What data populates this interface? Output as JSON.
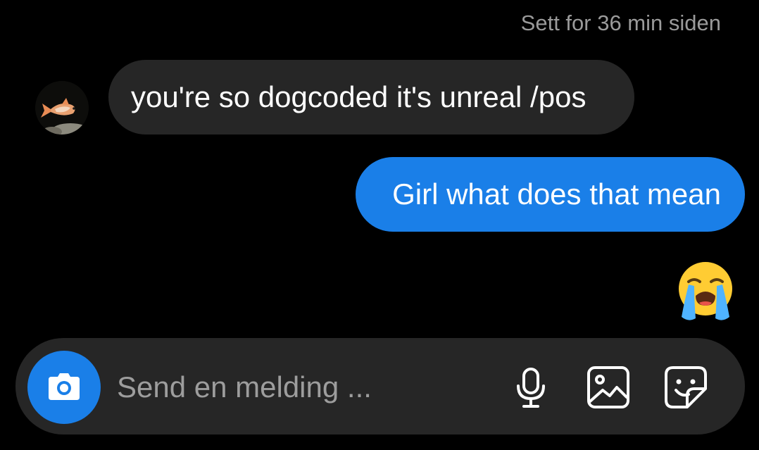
{
  "status": {
    "seen_text": "Sett for 36 min siden"
  },
  "messages": [
    {
      "direction": "incoming",
      "text": "you're so dogcoded it's unreal /pos"
    },
    {
      "direction": "outgoing",
      "text": "Girl what does that mean"
    }
  ],
  "reaction": {
    "icon": "loudly-crying-face-emoji"
  },
  "composer": {
    "placeholder": "Send en melding ...",
    "value": "",
    "buttons": [
      "camera-icon",
      "microphone-icon",
      "image-icon",
      "sticker-icon"
    ]
  },
  "colors": {
    "background": "#000000",
    "incoming_bubble": "#262626",
    "outgoing_bubble": "#1a7fe8",
    "composer": "#262626",
    "accent": "#1a7fe8",
    "muted_text": "#9a9a9a"
  }
}
